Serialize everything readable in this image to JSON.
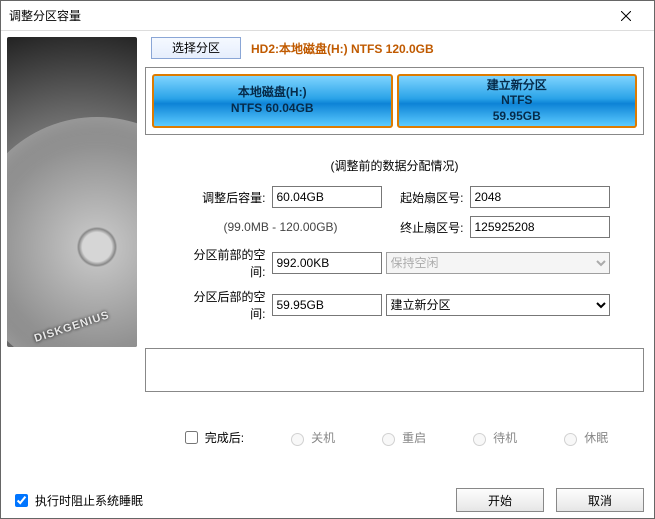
{
  "window": {
    "title": "调整分区容量"
  },
  "header": {
    "select_partition": "选择分区",
    "disk_desc": "HD2:本地磁盘(H:) NTFS 120.0GB"
  },
  "partitions": {
    "left": {
      "line1": "本地磁盘(H:)",
      "line2": "NTFS 60.04GB"
    },
    "right": {
      "line1": "建立新分区",
      "line2": "NTFS",
      "line3": "59.95GB"
    }
  },
  "hint": "(调整前的数据分配情况)",
  "form": {
    "after_size_label": "调整后容量:",
    "after_size_value": "60.04GB",
    "range_hint": "(99.0MB - 120.00GB)",
    "start_sector_label": "起始扇区号:",
    "start_sector_value": "2048",
    "end_sector_label": "终止扇区号:",
    "end_sector_value": "125925208",
    "front_space_label": "分区前部的空间:",
    "front_space_value": "992.00KB",
    "front_action": "保持空闲",
    "rear_space_label": "分区后部的空间:",
    "rear_space_value": "59.95GB",
    "rear_action": "建立新分区"
  },
  "after": {
    "checkbox_label": "完成后:",
    "opt_shutdown": "关机",
    "opt_reboot": "重启",
    "opt_standby": "待机",
    "opt_hibernate": "休眠"
  },
  "footer": {
    "prevent_sleep": "执行时阻止系统睡眠",
    "start": "开始",
    "cancel": "取消"
  }
}
